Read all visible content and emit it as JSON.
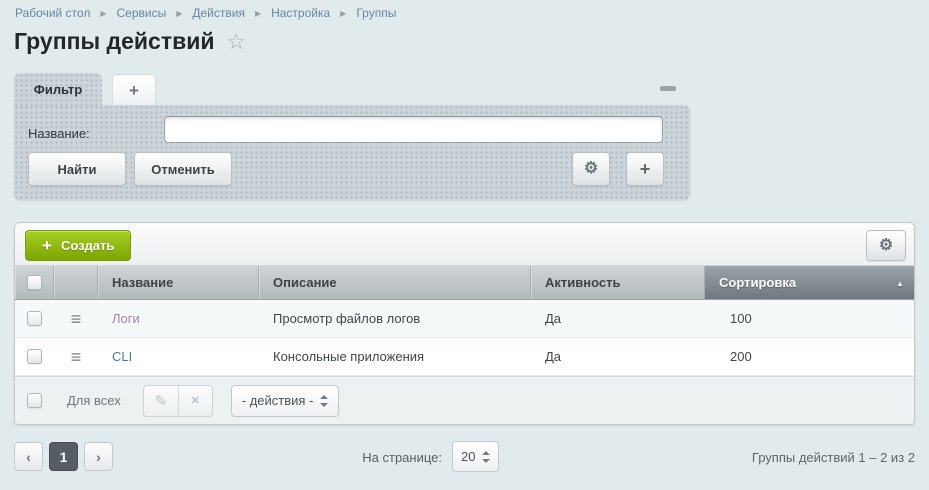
{
  "breadcrumb": {
    "items": [
      "Рабочий стол",
      "Сервисы",
      "Действия",
      "Настройка",
      "Группы"
    ]
  },
  "header": {
    "title": "Группы действий"
  },
  "filter": {
    "tab_label": "Фильтр",
    "name_label": "Название:",
    "name_value": "",
    "find_button": "Найти",
    "cancel_button": "Отменить"
  },
  "toolbar": {
    "create_button": "Создать"
  },
  "table": {
    "columns": [
      "Название",
      "Описание",
      "Активность",
      "Сортировка"
    ],
    "sorted_column": "Сортировка",
    "sort_direction": "asc",
    "rows": [
      {
        "name": "Логи",
        "description": "Просмотр файлов логов",
        "active": "Да",
        "sort": "100"
      },
      {
        "name": "CLI",
        "description": "Консольные приложения",
        "active": "Да",
        "sort": "200"
      }
    ],
    "footer": {
      "for_all_label": "Для всех",
      "actions_select": "- действия -"
    }
  },
  "pagination": {
    "prev": "‹",
    "current_page": "1",
    "next": "›",
    "per_page_label": "На странице:",
    "per_page_value": "20",
    "counter": "Группы действий 1 – 2 из 2"
  },
  "icons": {
    "star": "☆",
    "gear": "⚙",
    "plus": "+",
    "burger": "≡",
    "pencil": "✎",
    "close": "×",
    "sort_asc": "▲",
    "separator": "▶"
  },
  "colors": {
    "accent_green": "#8fb800",
    "page_bg": "#e1eaed",
    "header_dark": "#6f787e",
    "link_blue": "#5777a1",
    "link_visited": "#a186ad"
  }
}
